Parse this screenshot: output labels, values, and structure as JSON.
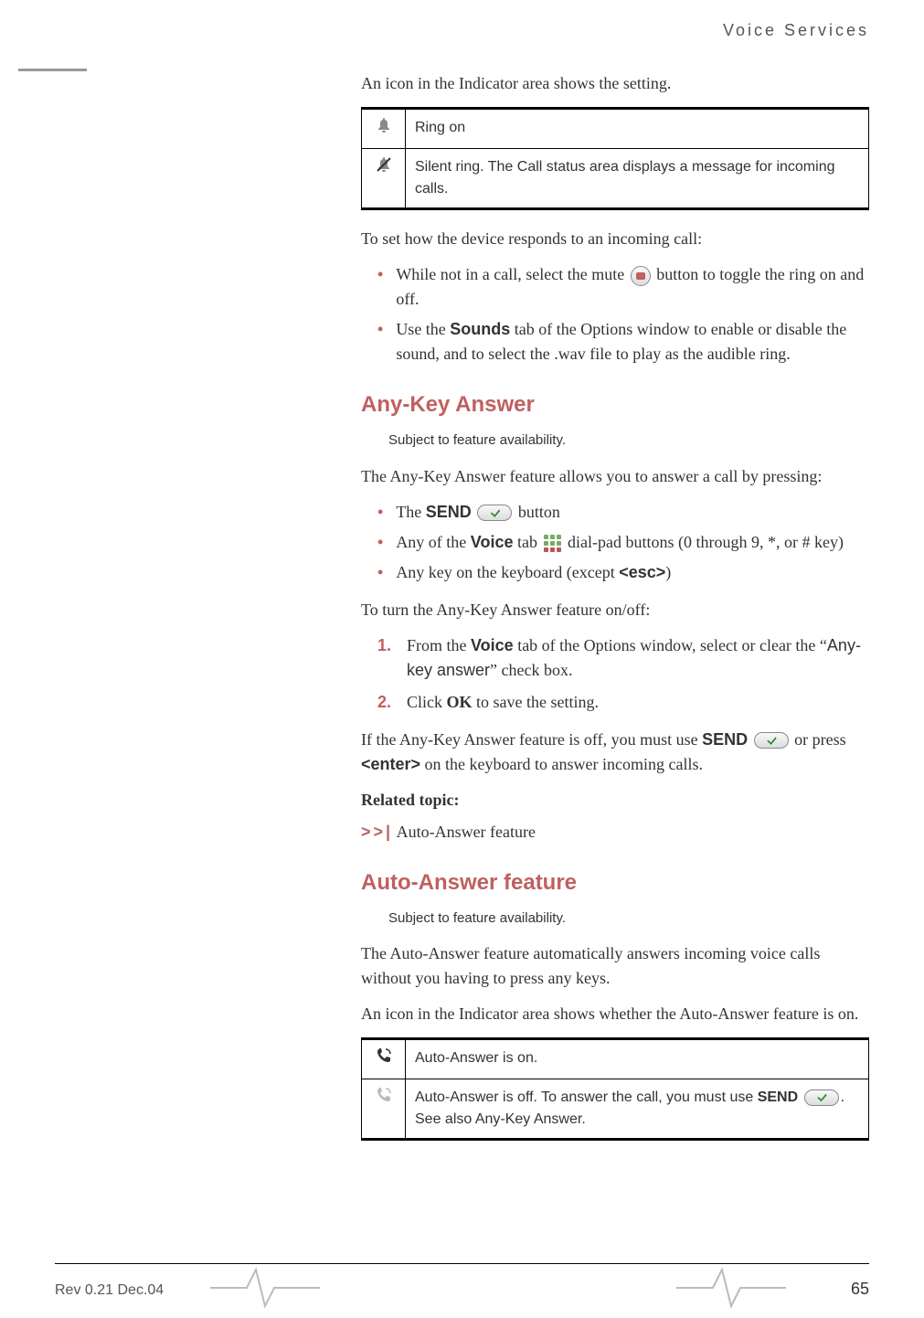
{
  "header": {
    "section_title": "Voice Services"
  },
  "footer": {
    "rev": "Rev 0.21  Dec.04",
    "page": "65"
  },
  "intro1": "An icon in the Indicator area shows the setting.",
  "ring_table": {
    "rows": [
      {
        "icon": "bell-icon",
        "text": "Ring on"
      },
      {
        "icon": "bell-off-icon",
        "text": "Silent ring. The Call status area displays a message for incoming calls."
      }
    ]
  },
  "howset": "To set how the device responds to an incoming call:",
  "bullets1": {
    "b1_pre": "While not in a call, select the mute ",
    "b1_post": " button to toggle the ring on and off.",
    "b2_pre": "Use the ",
    "b2_sounds": "Sounds",
    "b2_post": " tab of the Options window to enable or disable the sound, and to select the .wav file to play as the audible ring."
  },
  "anykey": {
    "heading": "Any-Key Answer",
    "note": "Subject to feature availability.",
    "intro": "The Any-Key Answer feature allows you to answer a call by pressing:",
    "b1_pre": "The ",
    "b1_send": "SEND",
    "b1_post": " button",
    "b2_pre": "Any of the ",
    "b2_voice": "Voice",
    "b2_mid": " tab ",
    "b2_post": " dial-pad buttons (0 through 9, *, or # key)",
    "b3_pre": "Any key on the keyboard (except ",
    "b3_esc": "<esc>",
    "b3_post": ")",
    "toggle_intro": "To turn the Any-Key Answer feature on/off:",
    "s1_pre": "From the ",
    "s1_voice": "Voice",
    "s1_mid": " tab of the Options window, select or clear the “",
    "s1_chk": "Any-key answer",
    "s1_post": "” check box.",
    "s2_pre": "Click ",
    "s2_ok": "OK",
    "s2_post": " to save the setting.",
    "off1_pre": "If the Any-Key Answer feature is off, you must use ",
    "off1_send": "SEND",
    "off2_pre": " or press ",
    "off2_enter": "<enter>",
    "off2_post": " on the keyboard to answer incoming calls.",
    "related": "Related topic:",
    "arrows": ">>|",
    "rel_link": " Auto-Answer feature"
  },
  "auto": {
    "heading": "Auto-Answer feature",
    "note": "Subject to feature availability.",
    "p1": "The Auto-Answer feature automatically answers incoming voice calls without you having to press any keys.",
    "p2": "An icon in the Indicator area shows whether the Auto-Answer feature is on.",
    "table": {
      "rows": [
        {
          "icon": "aa-on-icon",
          "text_pre": "Auto-Answer is on.",
          "has_send": false
        },
        {
          "icon": "aa-off-icon",
          "text_pre": "Auto-Answer is off. To answer the call, you must use ",
          "send": "SEND",
          "text_post": ". See also Any-Key Answer.",
          "has_send": true
        }
      ]
    }
  }
}
